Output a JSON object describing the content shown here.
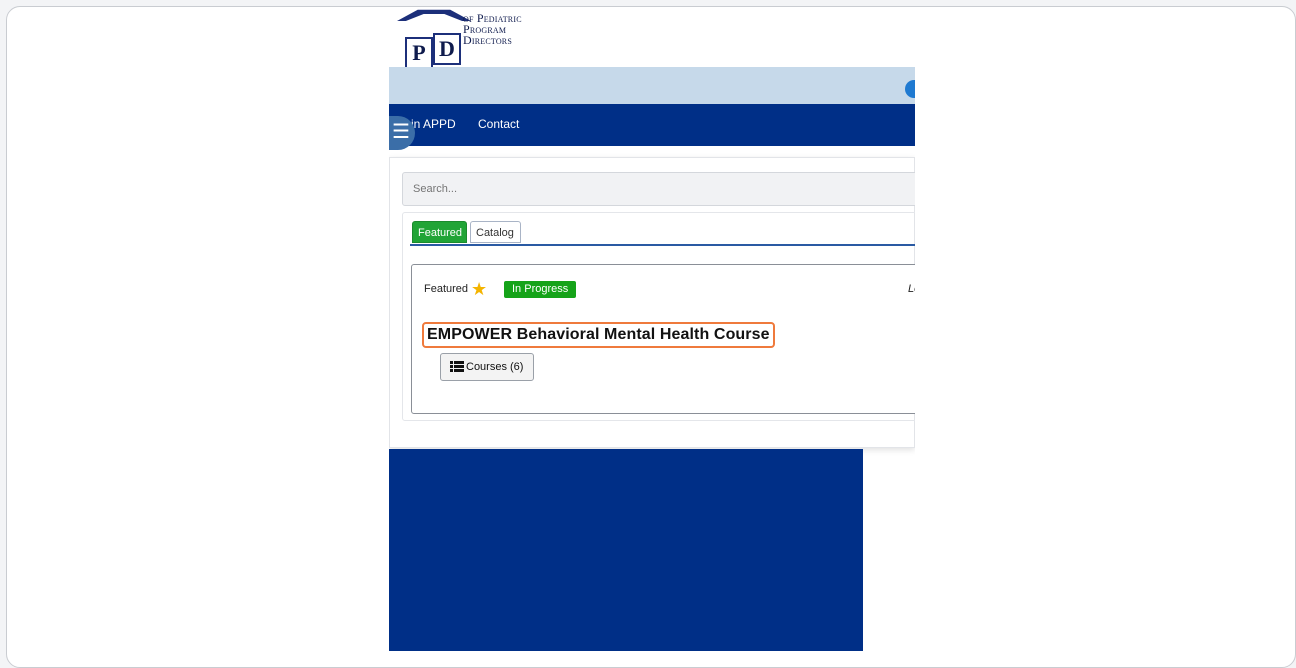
{
  "logo": {
    "letter_p": "P",
    "letter_d": "D",
    "line1": "of Pediatric",
    "line2": "Program",
    "line3": "Directors"
  },
  "nav": {
    "items": [
      {
        "label": "in APPD"
      },
      {
        "label": "Contact"
      }
    ],
    "menu_icon": "hamburger-icon"
  },
  "search": {
    "placeholder": "Search..."
  },
  "tabs": [
    {
      "label": "Featured",
      "active": true
    },
    {
      "label": "Catalog",
      "active": false
    }
  ],
  "course": {
    "featured_label": "Featured",
    "star_icon": "star-icon",
    "status": "In Progress",
    "right_meta": "Lo",
    "title": "EMPOWER Behavioral Mental Health Course",
    "courses_button": "Courses (6)",
    "courses_icon": "list-icon"
  },
  "colors": {
    "nav_blue": "#002f87",
    "top_bar": "#c6d9ea",
    "featured_tab": "#21a436",
    "status_green": "#15a319",
    "highlight": "#ef7a3c"
  }
}
